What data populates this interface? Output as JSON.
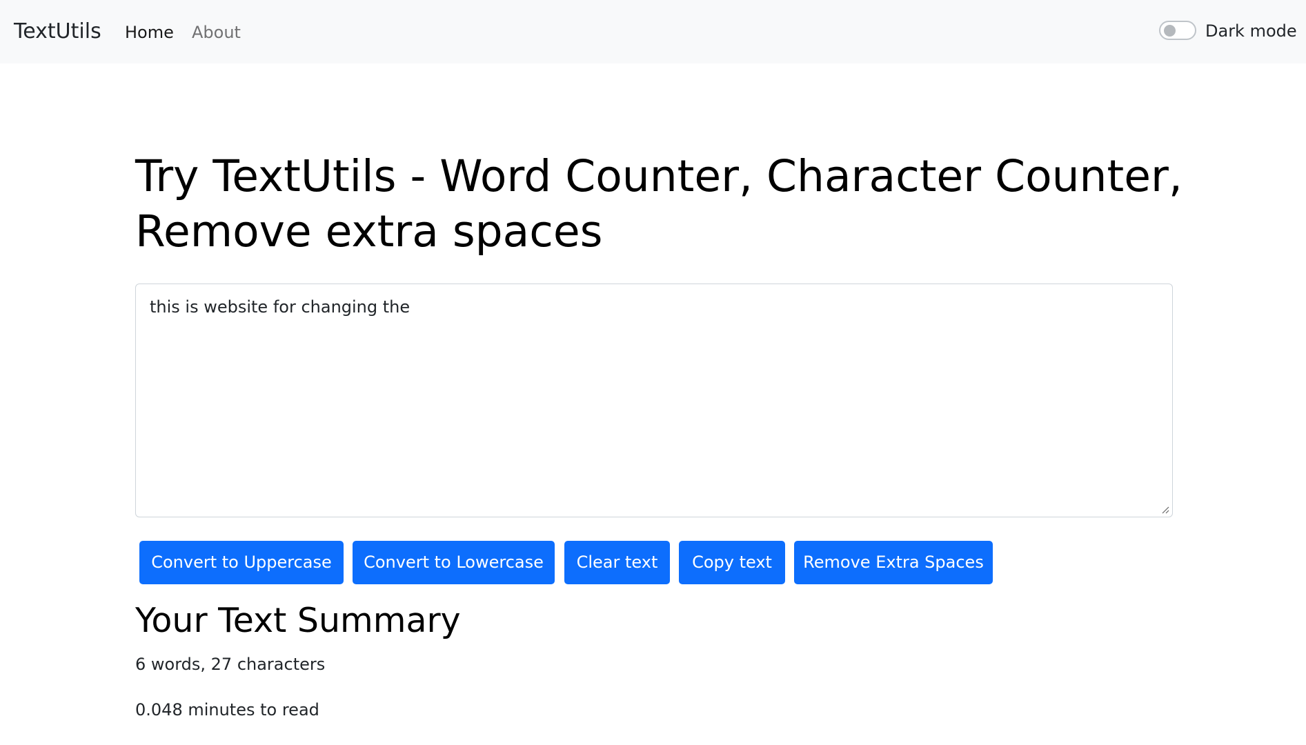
{
  "navbar": {
    "brand": "TextUtils",
    "links": [
      {
        "label": "Home",
        "active": true
      },
      {
        "label": "About",
        "active": false
      }
    ],
    "dark_mode": {
      "label": "Dark mode",
      "enabled": false
    }
  },
  "main": {
    "heading": "Try TextUtils - Word Counter, Character Counter, Remove extra spaces",
    "textarea": {
      "value": "this is website for changing the"
    },
    "buttons": {
      "uppercase": "Convert to Uppercase",
      "lowercase": "Convert to Lowercase",
      "clear": "Clear text",
      "copy": "Copy text",
      "remove_spaces": "Remove Extra Spaces"
    }
  },
  "summary": {
    "title": "Your Text Summary",
    "counts": "6 words, 27 characters",
    "read_time": "0.048 minutes to read"
  },
  "colors": {
    "primary": "#0d6efd",
    "navbar_bg": "#f8f9fa",
    "text": "#212529"
  }
}
